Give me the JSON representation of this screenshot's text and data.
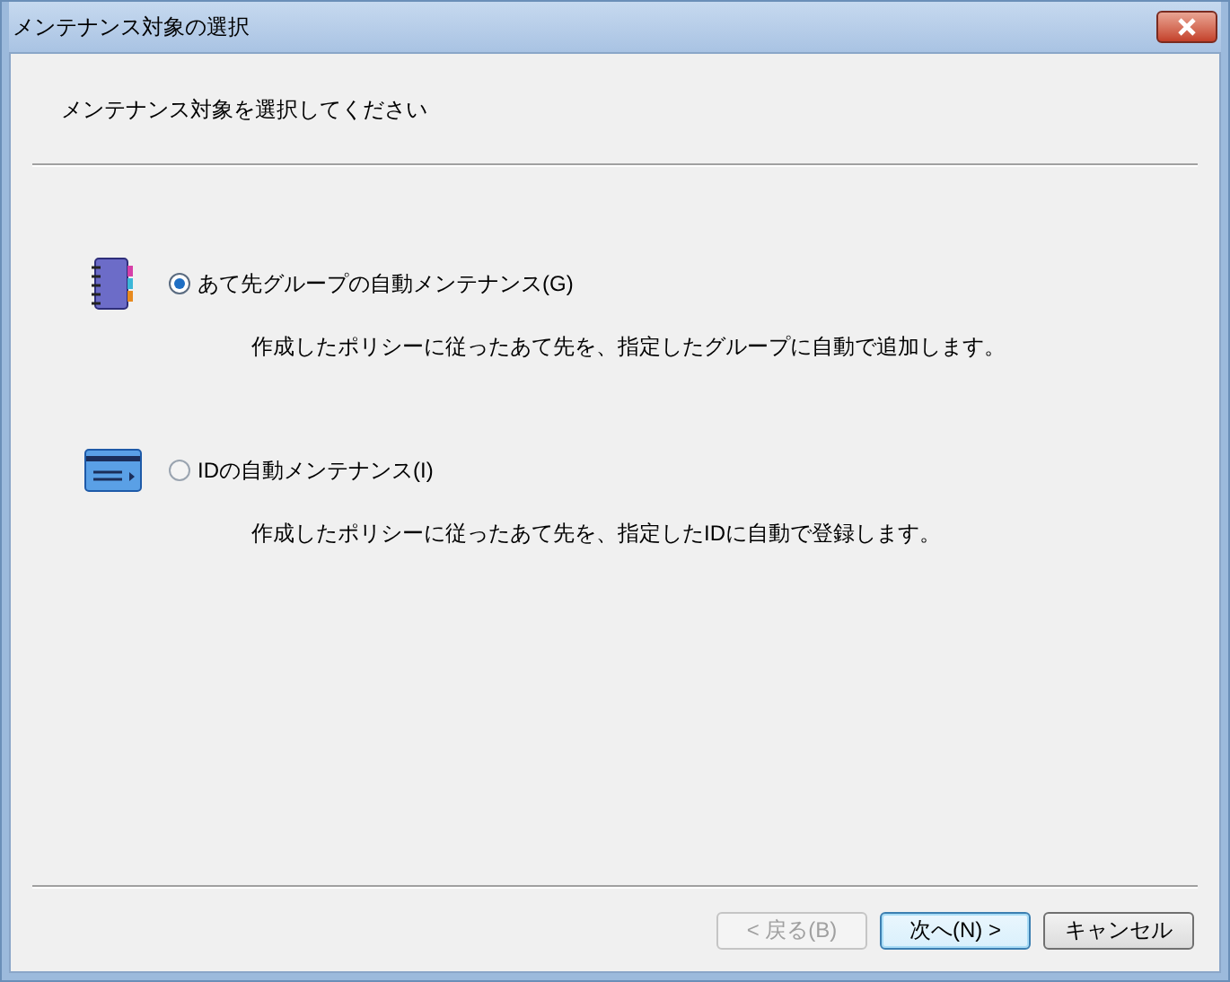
{
  "window": {
    "title": "メンテナンス対象の選択"
  },
  "instruction": "メンテナンス対象を選択してください",
  "options": [
    {
      "kind": "notebook",
      "label": "あて先グループの自動メンテナンス(G)",
      "description": "作成したポリシーに従ったあて先を、指定したグループに自動で追加します。",
      "selected": true
    },
    {
      "kind": "card",
      "label": "IDの自動メンテナンス(I)",
      "description": "作成したポリシーに従ったあて先を、指定したIDに自動で登録します。",
      "selected": false
    }
  ],
  "buttons": [
    {
      "label": "< 戻る(B)",
      "disabled": true,
      "default": false
    },
    {
      "label": "次へ(N) >",
      "disabled": false,
      "default": true
    },
    {
      "label": "キャンセル",
      "disabled": false,
      "default": false
    }
  ]
}
